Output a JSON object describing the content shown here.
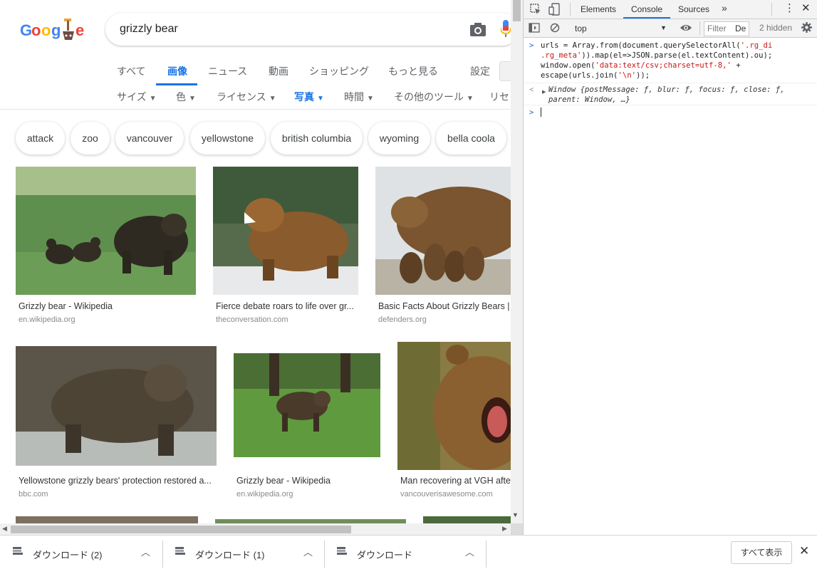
{
  "search": {
    "query": "grizzly bear"
  },
  "tabs": [
    {
      "label": "すべて"
    },
    {
      "label": "画像"
    },
    {
      "label": "ニュース"
    },
    {
      "label": "動画"
    },
    {
      "label": "ショッピング"
    },
    {
      "label": "もっと見る"
    },
    {
      "label": "設定"
    }
  ],
  "tools": [
    {
      "label": "サイズ"
    },
    {
      "label": "色"
    },
    {
      "label": "ライセンス"
    },
    {
      "label": "写真"
    },
    {
      "label": "時間"
    },
    {
      "label": "その他のツール"
    },
    {
      "label": "リセ"
    }
  ],
  "chips": [
    "attack",
    "zoo",
    "vancouver",
    "yellowstone",
    "british columbia",
    "wyoming",
    "bella coola"
  ],
  "results": [
    {
      "title": "Grizzly bear - Wikipedia",
      "source": "en.wikipedia.org"
    },
    {
      "title": "Fierce debate roars to life over gr...",
      "source": "theconversation.com"
    },
    {
      "title": "Basic Facts About Grizzly Bears |",
      "source": "defenders.org"
    },
    {
      "title": "Yellowstone grizzly bears' protection restored a...",
      "source": "bbc.com"
    },
    {
      "title": "Grizzly bear - Wikipedia",
      "source": "en.wikipedia.org"
    },
    {
      "title": "Man recovering at VGH afte",
      "source": "vancouverisawesome.com"
    }
  ],
  "devtools": {
    "tabs": [
      "Elements",
      "Console",
      "Sources"
    ],
    "context": "top",
    "filter_placeholder": "Filter",
    "levels": "De",
    "hidden": "2 hidden",
    "code": {
      "l1a": "urls = Array.from(document.querySelectorAll(",
      "l1b": "'.rg_di",
      "l2a": ".rg_meta'",
      "l2b": ")).map(el=>JSON.parse(el.textContent).ou);",
      "l3a": "window.open(",
      "l3b": "'data:text/csv;charset=utf-8,'",
      "l3c": " +",
      "l4a": "escape(urls.join(",
      "l4b": "'\\n'",
      "l4c": "));"
    },
    "result_1": "Window {postMessage: ƒ, blur: ƒ, focus: ƒ, close: ƒ,",
    "result_2": "parent: Window, …}"
  },
  "downloads": {
    "items": [
      {
        "label": "ダウンロード (2)"
      },
      {
        "label": "ダウンロード (1)"
      },
      {
        "label": "ダウンロード"
      }
    ],
    "show_all": "すべて表示"
  }
}
